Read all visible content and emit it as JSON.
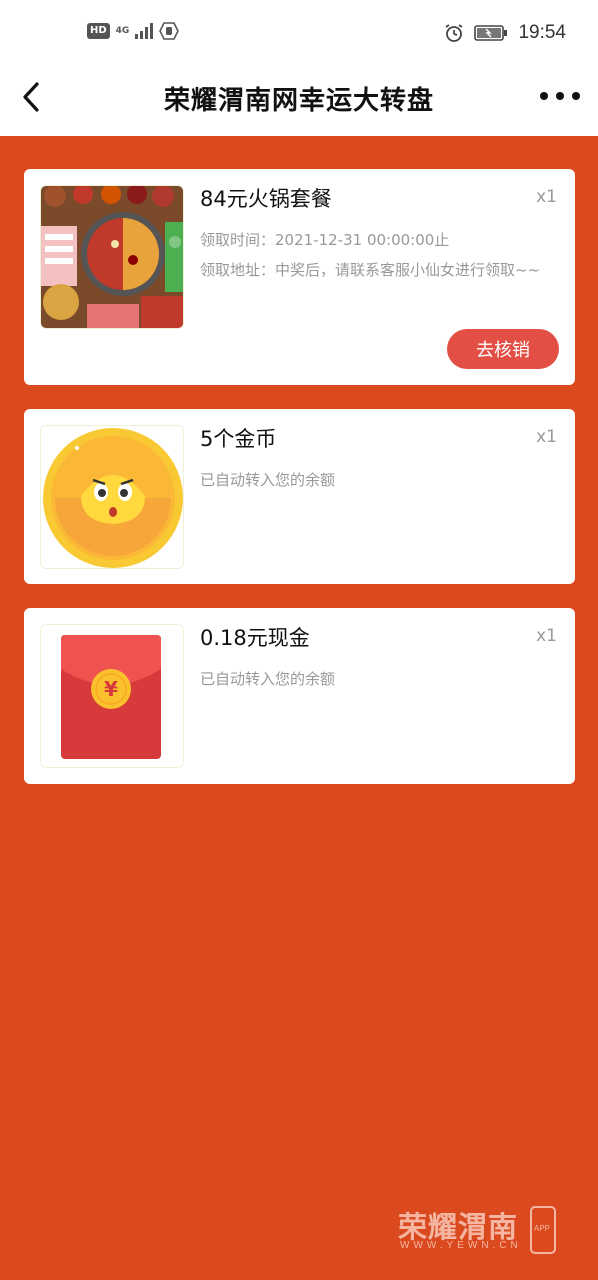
{
  "status_bar": {
    "hd_label": "HD",
    "network_label": "4G",
    "time": "19:54",
    "icons": [
      "signal-icon",
      "hand-icon",
      "alarm-icon",
      "battery-icon"
    ]
  },
  "header": {
    "title": "荣耀渭南网幸运大转盘",
    "back_icon": "back-arrow-icon",
    "more_icon": "more-dots-icon"
  },
  "prizes": [
    {
      "name": "84元火锅套餐",
      "quantity": "x1",
      "image": "hotpot-image",
      "claim_time": "领取时间：2021-12-31 00:00:00止",
      "claim_place": "领取地址：中奖后，请联系客服小仙女进行领取~~",
      "action_label": "去核销"
    },
    {
      "name": "5个金币",
      "quantity": "x1",
      "image": "gold-coin-image",
      "note": "已自动转入您的余额"
    },
    {
      "name": "0.18元现金",
      "quantity": "x1",
      "image": "red-envelope-image",
      "note": "已自动转入您的余额"
    }
  ],
  "watermark": {
    "brand": "荣耀渭南",
    "url": "WWW.YEWN.CN",
    "app": "APP"
  },
  "colors": {
    "background": "#db4a1f",
    "card": "#ffffff",
    "button": "#e34f44"
  }
}
